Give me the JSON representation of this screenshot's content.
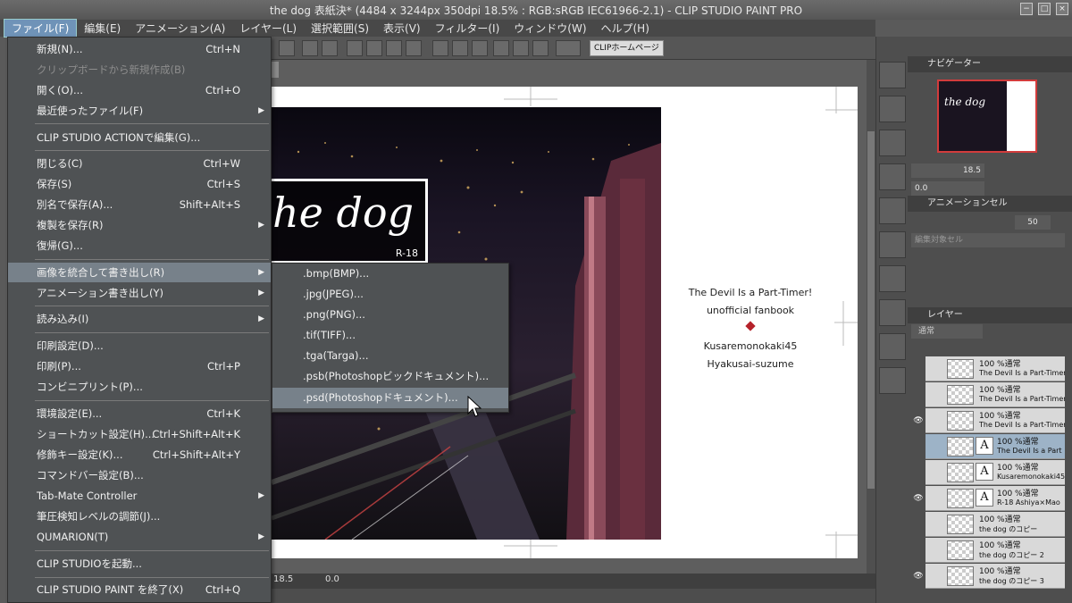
{
  "window": {
    "title": "the dog 表紙決* (4484 x 3244px 350dpi 18.5% : RGB:sRGB IEC61966-2.1) - CLIP STUDIO PAINT PRO",
    "minimize": "−",
    "maximize": "□",
    "close": "×"
  },
  "menubar": [
    {
      "label": "ファイル(F)"
    },
    {
      "label": "編集(E)"
    },
    {
      "label": "アニメーション(A)"
    },
    {
      "label": "レイヤー(L)"
    },
    {
      "label": "選択範囲(S)"
    },
    {
      "label": "表示(V)"
    },
    {
      "label": "フィルター(I)"
    },
    {
      "label": "ウィンドウ(W)"
    },
    {
      "label": "ヘルプ(H)"
    }
  ],
  "toolbar": {
    "clip_home_label": "CLIPホームページ"
  },
  "file_menu": [
    {
      "label": "新規(N)...",
      "shortcut": "Ctrl+N"
    },
    {
      "label": "クリップボードから新規作成(B)",
      "shortcut": "",
      "disabled": true
    },
    {
      "label": "開く(O)...",
      "shortcut": "Ctrl+O"
    },
    {
      "label": "最近使ったファイル(F)",
      "shortcut": "",
      "arrow": "▶"
    },
    {
      "label": "CLIP STUDIO ACTIONで編集(G)...",
      "shortcut": ""
    },
    {
      "label": "閉じる(C)",
      "shortcut": "Ctrl+W"
    },
    {
      "label": "保存(S)",
      "shortcut": "Ctrl+S"
    },
    {
      "label": "別名で保存(A)...",
      "shortcut": "Shift+Alt+S"
    },
    {
      "label": "複製を保存(R)",
      "shortcut": "",
      "arrow": "▶"
    },
    {
      "label": "復帰(G)...",
      "shortcut": ""
    },
    {
      "label": "画像を統合して書き出し(R)",
      "shortcut": "",
      "arrow": "▶"
    },
    {
      "label": "アニメーション書き出し(Y)",
      "shortcut": "",
      "arrow": "▶"
    },
    {
      "label": "読み込み(I)",
      "shortcut": "",
      "arrow": "▶"
    },
    {
      "label": "印刷設定(D)...",
      "shortcut": ""
    },
    {
      "label": "印刷(P)...",
      "shortcut": "Ctrl+P"
    },
    {
      "label": "コンビニプリント(P)...",
      "shortcut": ""
    },
    {
      "label": "環境設定(E)...",
      "shortcut": "Ctrl+K"
    },
    {
      "label": "ショートカット設定(H)...",
      "shortcut": "Ctrl+Shift+Alt+K"
    },
    {
      "label": "修飾キー設定(K)...",
      "shortcut": "Ctrl+Shift+Alt+Y"
    },
    {
      "label": "コマンドバー設定(B)...",
      "shortcut": ""
    },
    {
      "label": "Tab-Mate Controller",
      "shortcut": "",
      "arrow": "▶"
    },
    {
      "label": "筆圧検知レベルの調節(J)...",
      "shortcut": ""
    },
    {
      "label": "QUMARION(T)",
      "shortcut": "",
      "arrow": "▶"
    },
    {
      "label": "CLIP STUDIOを起動...",
      "shortcut": ""
    },
    {
      "label": "CLIP STUDIO PAINT を終了(X)",
      "shortcut": "Ctrl+Q"
    }
  ],
  "export_submenu": [
    {
      "label": ".bmp(BMP)..."
    },
    {
      "label": ".jpg(JPEG)..."
    },
    {
      "label": ".png(PNG)..."
    },
    {
      "label": ".tif(TIFF)..."
    },
    {
      "label": ".tga(Targa)..."
    },
    {
      "label": ".psb(Photoshopビックドキュメント)..."
    },
    {
      "label": ".psd(Photoshopドキュメント)..."
    }
  ],
  "canvas": {
    "cover_title": "he dog",
    "rating": "R-18",
    "back_lines": [
      "The Devil Is a Part-Timer!",
      "unofficial fanbook",
      "Kusaremonokaki45",
      "Hyakusai-suzume"
    ]
  },
  "navigator": {
    "tab_label": "ナビゲーター",
    "thumb_title": "the dog",
    "zoom_value": "18.5",
    "rotation_value": "0.0"
  },
  "animation_panel": {
    "tab_label": "アニメーションセル",
    "edit_target": "編集対象セル",
    "value": "50"
  },
  "layers": {
    "tab_label": "レイヤー",
    "blend_mode": "通常",
    "rows": [
      {
        "mode": "100 %通常",
        "name": "The Devil Is a Part-Timer",
        "eye": "",
        "text": false
      },
      {
        "mode": "100 %通常",
        "name": "The Devil Is a Part-Timer",
        "eye": "",
        "text": false
      },
      {
        "mode": "100 %通常",
        "name": "The Devil Is a Part-Timer",
        "eye": "👁",
        "text": false
      },
      {
        "mode": "100 %通常",
        "name": "The Devil Is a Part",
        "eye": "",
        "text": true
      },
      {
        "mode": "100 %通常",
        "name": "Kusaremonokaki45",
        "eye": "",
        "text": true
      },
      {
        "mode": "100 %通常",
        "name": "R-18 Ashiya×Mao",
        "eye": "👁",
        "text": true
      },
      {
        "mode": "100 %通常",
        "name": "the dog のコピー",
        "eye": "",
        "text": false
      },
      {
        "mode": "100 %通常",
        "name": "the dog のコピー 2",
        "eye": "",
        "text": false
      },
      {
        "mode": "100 %通常",
        "name": "the dog のコピー 3",
        "eye": "👁",
        "text": false
      }
    ]
  },
  "status": {
    "zoom": "18.5",
    "angle": "0.0"
  },
  "colors": {
    "accent": "#6f93b8",
    "menu_bg": "#4f5254",
    "highlight": "#77818a",
    "diamond": "#b5222a"
  }
}
